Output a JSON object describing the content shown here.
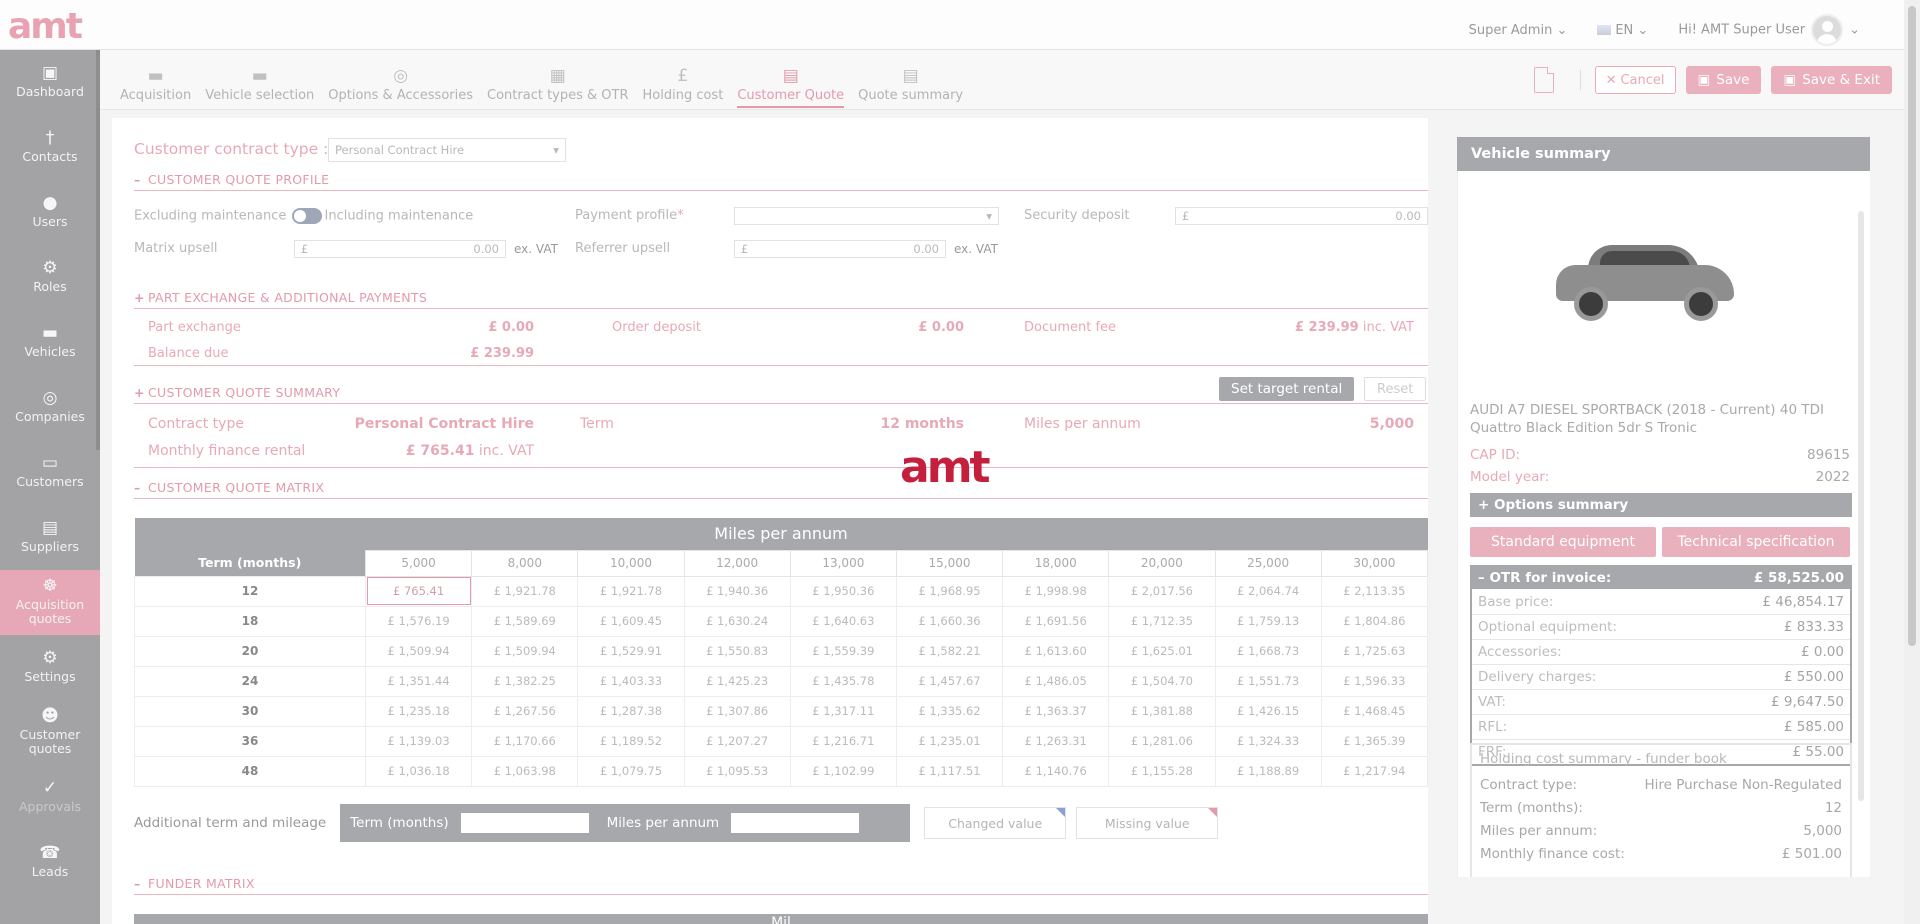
{
  "brand": {
    "logo_text": "amt",
    "watermark_text": "amt",
    "accent": "#e39aab",
    "accent_dark": "#c41f3c",
    "panel_grey": "#a7a8ab"
  },
  "topbar": {
    "role": "Super Admin",
    "language": "EN",
    "greeting": "Hi! AMT Super User"
  },
  "sidebar": {
    "items": [
      {
        "label": "Dashboard",
        "icon": "dashboard-icon",
        "glyph": "▣"
      },
      {
        "label": "Contacts",
        "icon": "contacts-icon",
        "glyph": "†"
      },
      {
        "label": "Users",
        "icon": "user-icon",
        "glyph": "●"
      },
      {
        "label": "Roles",
        "icon": "roles-icon",
        "glyph": "⚙"
      },
      {
        "label": "Vehicles",
        "icon": "car-icon",
        "glyph": "▬"
      },
      {
        "label": "Companies",
        "icon": "companies-icon",
        "glyph": "◎"
      },
      {
        "label": "Customers",
        "icon": "customers-icon",
        "glyph": "▭"
      },
      {
        "label": "Suppliers",
        "icon": "suppliers-icon",
        "glyph": "▤"
      },
      {
        "label": "Acquisition quotes",
        "icon": "acquisition-quotes-icon",
        "glyph": "☸"
      },
      {
        "label": "Settings",
        "icon": "settings-icon",
        "glyph": "⚙"
      },
      {
        "label": "Customer quotes",
        "icon": "customer-quotes-icon",
        "glyph": "☻"
      },
      {
        "label": "Approvals",
        "icon": "approvals-icon",
        "glyph": "✓"
      },
      {
        "label": "Leads",
        "icon": "leads-icon",
        "glyph": "☎"
      }
    ]
  },
  "tabs": [
    {
      "label": "Acquisition",
      "icon": "truck-icon",
      "glyph": "▬"
    },
    {
      "label": "Vehicle selection",
      "icon": "car-icon",
      "glyph": "▬"
    },
    {
      "label": "Options & Accessories",
      "icon": "options-icon",
      "glyph": "◎"
    },
    {
      "label": "Contract types & OTR",
      "icon": "calculator-icon",
      "glyph": "▦"
    },
    {
      "label": "Holding cost",
      "icon": "pound-coin-icon",
      "glyph": "£"
    },
    {
      "label": "Customer Quote",
      "icon": "quote-document-icon",
      "glyph": "▤"
    },
    {
      "label": "Quote summary",
      "icon": "summary-document-icon",
      "glyph": "▤"
    }
  ],
  "actions": {
    "cancel": "Cancel",
    "save": "Save",
    "save_exit": "Save & Exit"
  },
  "contract_type": {
    "label": "Customer contract type :",
    "value": "Personal Contract Hire"
  },
  "profile": {
    "title": "CUSTOMER QUOTE PROFILE",
    "excluding": "Excluding maintenance",
    "including": "Including maintenance",
    "payment_profile_label": "Payment profile",
    "required_mark": "*",
    "security_deposit_label": "Security deposit",
    "security_deposit_currency": "£",
    "security_deposit_value": "0.00",
    "matrix_upsell_label": "Matrix upsell",
    "matrix_upsell_currency": "£",
    "matrix_upsell_value": "0.00",
    "ex_vat": "ex. VAT",
    "referrer_upsell_label": "Referrer upsell",
    "referrer_upsell_currency": "£",
    "referrer_upsell_value": "0.00"
  },
  "part_exchange": {
    "title": "PART EXCHANGE & ADDITIONAL PAYMENTS",
    "part_exchange_label": "Part exchange",
    "part_exchange_value": "£ 0.00",
    "order_deposit_label": "Order deposit",
    "order_deposit_value": "£ 0.00",
    "document_fee_label": "Document fee",
    "document_fee_value": "£ 239.99",
    "inc_vat": "inc. VAT",
    "balance_due_label": "Balance due",
    "balance_due_value": "£ 239.99"
  },
  "summary": {
    "title": "CUSTOMER QUOTE SUMMARY",
    "set_target": "Set target rental",
    "reset": "Reset",
    "contract_type_label": "Contract type",
    "contract_type_value": "Personal Contract Hire",
    "term_label": "Term",
    "term_value": "12 months",
    "miles_label": "Miles per annum",
    "miles_value": "5,000",
    "monthly_label": "Monthly finance rental",
    "monthly_value": "£ 765.41",
    "inc_vat": "inc. VAT"
  },
  "matrix": {
    "title": "CUSTOMER QUOTE MATRIX",
    "header": "Miles per annum",
    "term_header": "Term (months)",
    "miles": [
      "5,000",
      "8,000",
      "10,000",
      "12,000",
      "13,000",
      "15,000",
      "18,000",
      "20,000",
      "25,000",
      "30,000"
    ],
    "rows": [
      {
        "term": "12",
        "values": [
          "£ 765.41",
          "£ 1,921.78",
          "£ 1,921.78",
          "£ 1,940.36",
          "£ 1,950.36",
          "£ 1,968.95",
          "£ 1,998.98",
          "£ 2,017.56",
          "£ 2,064.74",
          "£ 2,113.35"
        ]
      },
      {
        "term": "18",
        "values": [
          "£ 1,576.19",
          "£ 1,589.69",
          "£ 1,609.45",
          "£ 1,630.24",
          "£ 1,640.63",
          "£ 1,660.36",
          "£ 1,691.56",
          "£ 1,712.35",
          "£ 1,759.13",
          "£ 1,804.86"
        ]
      },
      {
        "term": "20",
        "values": [
          "£ 1,509.94",
          "£ 1,509.94",
          "£ 1,529.91",
          "£ 1,550.83",
          "£ 1,559.39",
          "£ 1,582.21",
          "£ 1,613.60",
          "£ 1,625.01",
          "£ 1,668.73",
          "£ 1,725.63"
        ]
      },
      {
        "term": "24",
        "values": [
          "£ 1,351.44",
          "£ 1,382.25",
          "£ 1,403.33",
          "£ 1,425.23",
          "£ 1,435.78",
          "£ 1,457.67",
          "£ 1,486.05",
          "£ 1,504.70",
          "£ 1,551.73",
          "£ 1,596.33"
        ]
      },
      {
        "term": "30",
        "values": [
          "£ 1,235.18",
          "£ 1,267.56",
          "£ 1,287.38",
          "£ 1,307.86",
          "£ 1,317.11",
          "£ 1,335.62",
          "£ 1,363.37",
          "£ 1,381.88",
          "£ 1,426.15",
          "£ 1,468.45"
        ]
      },
      {
        "term": "36",
        "values": [
          "£ 1,139.03",
          "£ 1,170.66",
          "£ 1,189.52",
          "£ 1,207.27",
          "£ 1,216.71",
          "£ 1,235.01",
          "£ 1,263.31",
          "£ 1,281.06",
          "£ 1,324.33",
          "£ 1,365.39"
        ]
      },
      {
        "term": "48",
        "values": [
          "£ 1,036.18",
          "£ 1,063.98",
          "£ 1,079.75",
          "£ 1,095.53",
          "£ 1,102.99",
          "£ 1,117.51",
          "£ 1,140.76",
          "£ 1,155.28",
          "£ 1,188.89",
          "£ 1,217.94"
        ]
      }
    ]
  },
  "additional": {
    "label": "Additional term and mileage",
    "term_label": "Term (months)",
    "miles_label": "Miles per annum",
    "changed": "Changed value",
    "missing": "Missing value"
  },
  "funder_matrix": {
    "title": "FUNDER MATRIX",
    "partial_header": "Mil"
  },
  "vehicle_summary": {
    "title": "Vehicle summary",
    "name": "AUDI A7 DIESEL SPORTBACK (2018 - Current) 40 TDI Quattro Black Edition 5dr S Tronic",
    "cap_id_label": "CAP ID:",
    "cap_id_value": "89615",
    "model_year_label": "Model year:",
    "model_year_value": "2022",
    "options_summary": "Options summary",
    "standard_equipment": "Standard equipment",
    "technical_specification": "Technical specification",
    "otr_label": "OTR for invoice:",
    "otr_value": "£ 58,525.00",
    "otr_rows": [
      {
        "label": "Base price:",
        "value": "£ 46,854.17"
      },
      {
        "label": "Optional equipment:",
        "value": "£ 833.33"
      },
      {
        "label": "Accessories:",
        "value": "£ 0.00"
      },
      {
        "label": "Delivery charges:",
        "value": "£ 550.00"
      },
      {
        "label": "VAT:",
        "value": "£ 9,647.50"
      },
      {
        "label": "RFL:",
        "value": "£ 585.00"
      },
      {
        "label": "FRF:",
        "value": "£ 55.00"
      }
    ],
    "holding_title": "Holding cost summary - funder book",
    "holding_rows": [
      {
        "label": "Contract type:",
        "value": "Hire Purchase Non-Regulated"
      },
      {
        "label": "Term (months):",
        "value": "12"
      },
      {
        "label": "Miles per annum:",
        "value": "5,000"
      },
      {
        "label": "Monthly finance cost:",
        "value": "£ 501.00"
      }
    ]
  }
}
